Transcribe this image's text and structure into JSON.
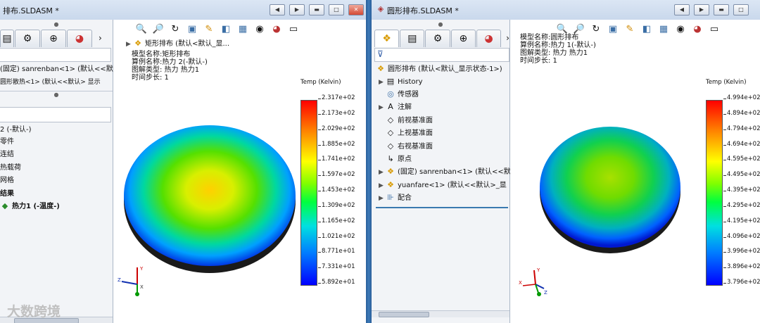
{
  "left": {
    "title": "排布.SLDASM *",
    "tree_rows": [
      "(固定) sanrenban<1> (默认<<默",
      "圆形散热<1> (默认<<默认> 显示",
      "2 (-默认-)",
      "零件",
      "连结",
      "热载荷",
      "网格",
      "结果",
      "热力1 (-温度-)"
    ],
    "model_header": "矩形排布 (默认<默认_显...",
    "info": [
      "模型名称:矩形排布",
      "算例名称:热力 2(-默认-)",
      "图解类型: 热力 热力1",
      "时间步长: 1"
    ],
    "legend_title": "Temp (Kelvin)",
    "ticks": [
      "2.317e+02",
      "2.173e+02",
      "2.029e+02",
      "1.885e+02",
      "1.741e+02",
      "1.597e+02",
      "1.453e+02",
      "1.309e+02",
      "1.165e+02",
      "1.021e+02",
      "8.771e+01",
      "7.331e+01",
      "5.892e+01"
    ]
  },
  "right": {
    "title": "圆形排布.SLDASM *",
    "info": [
      "模型名称:圆形排布",
      "算例名称:热力 1(-默认-)",
      "图解类型: 热力 热力1",
      "时间步长: 1"
    ],
    "tree_rows": [
      "圆形排布 (默认<默认_显示状态-1>)",
      "History",
      "传感器",
      "注解",
      "前视基准面",
      "上视基准面",
      "右视基准面",
      "原点",
      "(固定) sanrenban<1> (默认<<默",
      "yuanfare<1> (默认<<默认>_显",
      "配合"
    ],
    "legend_title": "Temp (Kelvin)",
    "ticks": [
      "4.994e+02",
      "4.894e+02",
      "4.794e+02",
      "4.694e+02",
      "4.595e+02",
      "4.495e+02",
      "4.395e+02",
      "4.295e+02",
      "4.195e+02",
      "4.096e+02",
      "3.996e+02",
      "3.896e+02",
      "3.796e+02"
    ]
  },
  "watermark": "大数跨境",
  "icons": [
    "search-icon",
    "zoom-area-icon",
    "rotate-icon",
    "section-view-icon",
    "display-style-icon",
    "hide-show-icon",
    "appearance-icon",
    "scene-icon",
    "monitor-icon",
    "filter-icon",
    "assembly-icon",
    "part-icon",
    "folder-icon",
    "sensor-icon",
    "annotation-icon",
    "plane-icon",
    "origin-icon",
    "mates-icon"
  ],
  "colors": {
    "accent": "#1e4e84",
    "legend_top": "#ff0000",
    "legend_bottom": "#0000ff"
  }
}
